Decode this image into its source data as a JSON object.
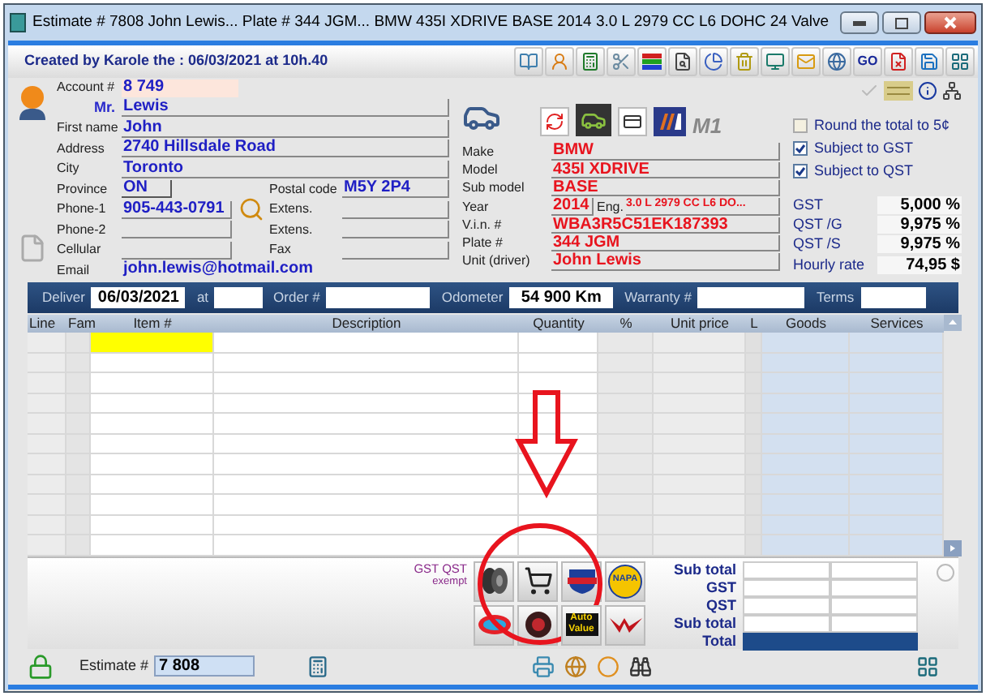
{
  "window": {
    "title": "Estimate # 7808    John Lewis... Plate # 344 JGM... BMW 435I XDRIVE BASE 2014 3.0 L 2979 CC L6 DOHC 24 Valve"
  },
  "header": {
    "created_by": "Created by Karole the : 06/03/2021 at 10h.40",
    "go_label": "GO"
  },
  "customer": {
    "account_label": "Account #",
    "account": "8 749",
    "title": "Mr.",
    "last_name": "Lewis",
    "fields": [
      {
        "label": "First name",
        "value": "John"
      },
      {
        "label": "Address",
        "value": "2740 Hillsdale Road"
      },
      {
        "label": "City",
        "value": "Toronto"
      }
    ],
    "province_label": "Province",
    "province": "ON",
    "postal_label": "Postal code",
    "postal": "M5Y 2P4",
    "phones": [
      {
        "label": "Phone-1",
        "value": "905-443-0791",
        "side_label": "Extens."
      },
      {
        "label": "Phone-2",
        "side_label": "Extens."
      },
      {
        "label": "Cellular",
        "side_label": "Fax"
      }
    ],
    "email_label": "Email",
    "email": "john.lewis@hotmail.com"
  },
  "vehicle": {
    "badge_text": "M1",
    "fields": [
      {
        "label": "Make",
        "value": "BMW"
      },
      {
        "label": "Model",
        "value": "435I XDRIVE"
      },
      {
        "label": "Sub model",
        "value": "BASE"
      },
      {
        "label": "Year",
        "value": "2014",
        "extra_label": "Eng.",
        "extra": "3.0 L 2979 CC L6 DO..."
      },
      {
        "label": "V.i.n. #",
        "value": "WBA3R5C51EK187393"
      },
      {
        "label": "Plate #",
        "value": "344 JGM"
      },
      {
        "label": "Unit (driver)",
        "value": "John Lewis"
      }
    ]
  },
  "options": [
    {
      "label": "Round the total to 5¢",
      "checked": false
    },
    {
      "label": "Subject to GST",
      "checked": true
    },
    {
      "label": "Subject to QST",
      "checked": true
    }
  ],
  "rates": [
    {
      "label": "GST",
      "value": "5,000 %"
    },
    {
      "label": "QST /G",
      "value": "9,975 %"
    },
    {
      "label": "QST /S",
      "value": "9,975 %"
    },
    {
      "label": "Hourly rate",
      "value": "74,95 $"
    }
  ],
  "order_bar": [
    {
      "label": "Deliver",
      "value": "06/03/2021"
    },
    {
      "label": "at"
    },
    {
      "label": "Order #"
    },
    {
      "label": "Odometer",
      "value": "54 900 Km"
    },
    {
      "label": "Warranty #"
    },
    {
      "label": "Terms"
    }
  ],
  "table": {
    "columns": [
      {
        "label": "Line",
        "focused": false
      },
      {
        "label": "Fam",
        "focused": false
      },
      {
        "label": "Item #",
        "focused": true
      },
      {
        "label": "Description",
        "focused": false
      },
      {
        "label": "Quantity",
        "focused": false
      },
      {
        "label": "%",
        "focused": false
      },
      {
        "label": "Unit price",
        "focused": false
      },
      {
        "label": "L",
        "focused": false
      },
      {
        "label": "Goods",
        "focused": false
      },
      {
        "label": "Services",
        "focused": false
      }
    ]
  },
  "exempt": {
    "line_1": "GST QST",
    "line_2": "exempt"
  },
  "suppliers": [
    {
      "kind": "tires"
    },
    {
      "kind": "cart"
    },
    {
      "kind": "shield"
    },
    {
      "kind": "napa",
      "text": "NAPA"
    },
    {
      "kind": "oval"
    },
    {
      "kind": "wheel"
    },
    {
      "kind": "autovalue",
      "text": "Auto Value"
    },
    {
      "kind": "wings"
    }
  ],
  "totals": [
    {
      "label": "Sub total",
      "kind": "line"
    },
    {
      "label": "GST",
      "kind": "line"
    },
    {
      "label": "QST",
      "kind": "line"
    },
    {
      "label": "Sub total",
      "kind": "line"
    },
    {
      "label": "Total",
      "kind": "total"
    }
  ],
  "footer": {
    "estimate_label": "Estimate #",
    "estimate": "7 808"
  }
}
